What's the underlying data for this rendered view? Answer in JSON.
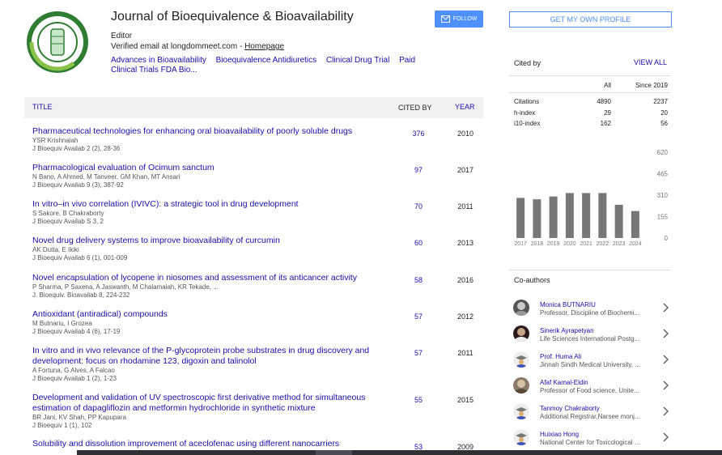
{
  "header": {
    "journal_title": "Journal of Bioequivalence & Bioavailability",
    "role": "Editor",
    "verified_text": "Verified email at longdommeet.com - ",
    "homepage_label": "Homepage",
    "interests": [
      "Advances in Bioavailability",
      "Bioequivalence Antidiuretics",
      "Clinical Drug Trial",
      "Paid Clinical Trials FDA Bio..."
    ],
    "follow_label": "FOLLOW"
  },
  "table": {
    "col_title": "TITLE",
    "col_cited": "CITED BY",
    "col_year": "YEAR",
    "rows": [
      {
        "title": "Pharmaceutical technologies for enhancing oral bioavailability of poorly soluble drugs",
        "authors": "YSR Krishnaiah",
        "venue": "J Bioequiv Availab 2 (2), 28-36",
        "cites": "376",
        "year": "2010"
      },
      {
        "title": "Pharmacological evaluation of Ocimum sanctum",
        "authors": "N Bano, A Ahmed, M Tanveer, GM Khan, MT Ansari",
        "venue": "J Bioequiv Availab 9 (3), 387-92",
        "cites": "97",
        "year": "2017"
      },
      {
        "title": "In vitro–in vivo correlation (IVIVC): a strategic tool in drug development",
        "authors": "S Sakore, B Chakraborty",
        "venue": "J Bioequiv Availab S 3, 2",
        "cites": "70",
        "year": "2011"
      },
      {
        "title": "Novel drug delivery systems to improve bioavailability of curcumin",
        "authors": "AK Dutta, E Ikiki",
        "venue": "J Bioequiv Availab 6 (1), 001-009",
        "cites": "60",
        "year": "2013"
      },
      {
        "title": "Novel encapsulation of lycopene in niosomes and assessment of its anticancer activity",
        "authors": "P Sharma, P Saxena, A Jaswanth, M Chalamaiah, KR Tekade, ...",
        "venue": "J. Bioequiv. Bioavailab 8, 224-232",
        "cites": "58",
        "year": "2016"
      },
      {
        "title": "Antioxidant (antiradical) compounds",
        "authors": "M Butnariu, I Grozea",
        "venue": "J Bioequiv Availab 4 (6), 17-19",
        "cites": "57",
        "year": "2012"
      },
      {
        "title": "In vitro and in vivo relevance of the P-glycoprotein probe substrates in drug discovery and development: focus on rhodamine 123, digoxin and talinolol",
        "authors": "A Fortuna, G Alves, A Falcao",
        "venue": "J Bioequiv Availab 1 (2), 1-23",
        "cites": "57",
        "year": "2011"
      },
      {
        "title": "Development and validation of UV spectroscopic first derivative method for simultaneous estimation of dapagliflozin and metformin hydrochloride in synthetic mixture",
        "authors": "BR Jani, KV Shah, PP Kapupara",
        "venue": "J Bioequiv 1 (1), 102",
        "cites": "55",
        "year": "2015"
      },
      {
        "title": "Solubility and dissolution improvement of aceclofenac using different nanocarriers",
        "authors": "",
        "venue": "",
        "cites": "53",
        "year": "2009"
      }
    ]
  },
  "sidebar": {
    "profile_button": "GET MY OWN PROFILE",
    "cited_by_label": "Cited by",
    "view_all": "VIEW ALL",
    "stats_headers": [
      "",
      "All",
      "Since 2019"
    ],
    "stats": [
      {
        "label": "Citations",
        "all": "4890",
        "since": "2237"
      },
      {
        "label": "h-index",
        "all": "29",
        "since": "20"
      },
      {
        "label": "i10-index",
        "all": "162",
        "since": "56"
      }
    ],
    "coauthors_title": "Co-authors",
    "coauthors": [
      {
        "name": "Monica BUTNARIU",
        "affiliation": "Professor, Discipline of Biochemi...",
        "avatar": "photo"
      },
      {
        "name": "Sinerik Ayrapetyan",
        "affiliation": "Life Sciences International Postg...",
        "avatar": "photo-dark"
      },
      {
        "name": "Prof. Huma Ali",
        "affiliation": "Jinnah Sindh Medical University, ...",
        "avatar": "graduate"
      },
      {
        "name": "Afaf Kamal-Eldin",
        "affiliation": "Professor of Food science, Unite...",
        "avatar": "photo"
      },
      {
        "name": "Tanmoy Chakraborty",
        "affiliation": "Additional Registrar,Narsee monj...",
        "avatar": "graduate"
      },
      {
        "name": "Huixiao Hong",
        "affiliation": "National Center for Toxicological ...",
        "avatar": "graduate"
      }
    ]
  },
  "chart_data": {
    "type": "bar",
    "categories": [
      "2017",
      "2018",
      "2019",
      "2020",
      "2021",
      "2022",
      "2023",
      "2024"
    ],
    "values": [
      290,
      280,
      300,
      325,
      325,
      325,
      240,
      195
    ],
    "ylim": [
      0,
      620
    ],
    "yticks": [
      "620",
      "465",
      "310",
      "155",
      "0"
    ],
    "bar_color": "#777777"
  }
}
